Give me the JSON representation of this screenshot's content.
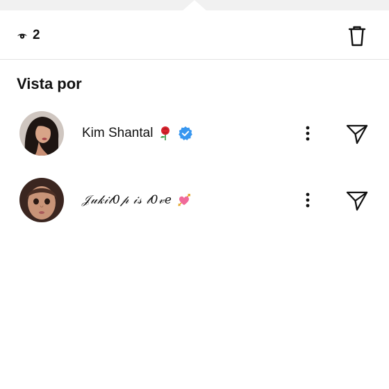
{
  "header": {
    "view_count": "2",
    "eye_icon": "eye-icon",
    "delete_icon": "trash-icon"
  },
  "section": {
    "title": "Vista por"
  },
  "viewers": [
    {
      "name": "Kim Shantal",
      "emoji": "rose-emoji",
      "verified": true,
      "verified_color": "#3897f0",
      "avatar": "profile-photo",
      "more_icon": "more-vertical-icon",
      "send_icon": "paper-plane-icon"
    },
    {
      "name": "𝒥𝓊𝓀𝒾𝓁0𝓅 𝒾𝓈 𝓁0𝓋𝑒",
      "emoji": "heart-with-arrow-emoji",
      "verified": false,
      "avatar": "profile-photo",
      "more_icon": "more-vertical-icon",
      "send_icon": "paper-plane-icon"
    }
  ],
  "colors": {
    "background": "#ffffff",
    "text": "#111111",
    "divider": "#e3e3e3",
    "top_strip": "#f1f1f1"
  }
}
